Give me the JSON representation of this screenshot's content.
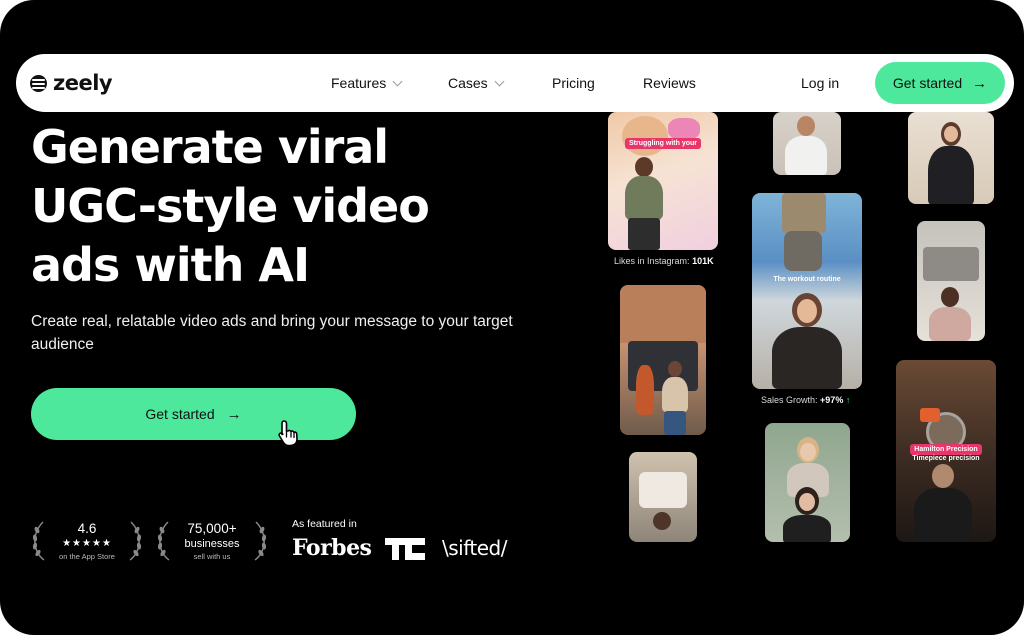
{
  "nav": {
    "logo": "zeely",
    "items": [
      {
        "label": "Features",
        "has_dropdown": true
      },
      {
        "label": "Cases",
        "has_dropdown": true
      },
      {
        "label": "Pricing",
        "has_dropdown": false
      },
      {
        "label": "Reviews",
        "has_dropdown": false
      }
    ],
    "login": "Log in",
    "cta": "Get started"
  },
  "hero": {
    "headline_lines": [
      "Generate viral",
      "UGC-style video",
      "ads with AI"
    ],
    "subtext": "Create real, relatable video ads and bring your message to your target audience",
    "cta": "Get started"
  },
  "proof": {
    "rating": {
      "value": "4.6",
      "stars": "★★★★★",
      "caption": "on the App Store"
    },
    "businesses": {
      "value": "75,000+",
      "label": "businesses",
      "caption": "sell with us"
    },
    "featured_label": "As featured in",
    "logos": [
      "Forbes",
      "TC",
      "\\sifted/"
    ]
  },
  "tiles": {
    "t1_caption": "Struggling with your",
    "t1_stat_label": "Likes in Instagram:",
    "t1_stat_value": "101K",
    "t4_caption": "The workout routine",
    "t4_stat_label": "Sales Growth:",
    "t4_stat_value": "+97%",
    "t4_stat_arrow": "↑",
    "t6_caption_1": "Hamilton Precision",
    "t6_caption_2": "Timepiece precision"
  },
  "colors": {
    "accent": "#4de89b",
    "background": "#000000",
    "caption_pill": "#e8366b"
  },
  "icons": {
    "cta_arrow": "→",
    "cursor": "hand-pointer-icon"
  }
}
